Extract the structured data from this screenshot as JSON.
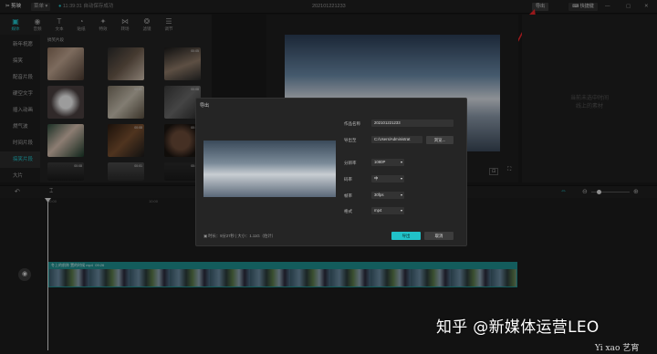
{
  "titlebar": {
    "app_name": "剪映",
    "menu_label": "菜单",
    "autosave": "11:39:31 自动保存成功",
    "project_title": "202101221233",
    "export_label": "导出",
    "shortcut_label": "快捷键"
  },
  "toolbar": {
    "items": [
      {
        "label": "媒体",
        "icon": "media-icon"
      },
      {
        "label": "音频",
        "icon": "audio-icon"
      },
      {
        "label": "文本",
        "icon": "text-icon"
      },
      {
        "label": "贴纸",
        "icon": "sticker-icon"
      },
      {
        "label": "特效",
        "icon": "effects-icon"
      },
      {
        "label": "转场",
        "icon": "transition-icon"
      },
      {
        "label": "滤镜",
        "icon": "filter-icon"
      },
      {
        "label": "调节",
        "icon": "adjust-icon"
      }
    ]
  },
  "sidebar": {
    "items": [
      {
        "label": "新年祝愿"
      },
      {
        "label": "搞笑"
      },
      {
        "label": "配音片段"
      },
      {
        "label": "硬空文字"
      },
      {
        "label": "插入动画"
      },
      {
        "label": "燃气波"
      },
      {
        "label": "时间片段"
      },
      {
        "label": "搞笑片段"
      },
      {
        "label": "大片"
      }
    ]
  },
  "grid": {
    "title": "搞笑片段",
    "durations": [
      "",
      "",
      "00:05",
      "",
      "00:01",
      "00:08",
      "",
      "00:08",
      "00:01",
      "00:08",
      "00:01",
      "00:08",
      "",
      "",
      ""
    ]
  },
  "player": {
    "placeholder": ""
  },
  "rightpanel": {
    "empty_line1": "当前未选中时间",
    "empty_line2": "线上的素材"
  },
  "timeline": {
    "ruler": [
      "00:00",
      "10:00",
      "20:00",
      "30:00"
    ],
    "clip_name": "冬上的前阵 置的时候 mp4",
    "clip_duration": "09:26"
  },
  "dialog": {
    "title": "导出",
    "name_label": "作品名称",
    "name_value": "202101221233",
    "path_label": "导出至",
    "path_value": "C:/Users/Administrat",
    "browse_label": "浏览...",
    "resolution_label": "分辨率",
    "resolution_value": "1080P",
    "bitrate_label": "码率",
    "bitrate_value": "中",
    "fps_label": "帧率",
    "fps_value": "30fps",
    "format_label": "格式",
    "format_value": "mp4",
    "info": "时长：9分27秒 | 大小：1.11G（估计）",
    "export_button": "导出",
    "cancel_button": "取消"
  },
  "watermark": {
    "text": "知乎 @新媒体运营LEO",
    "corner": "Yi xao 艺宵"
  },
  "colors": {
    "accent": "#21c2c9",
    "arrow": "#e8262a",
    "clip": "#1e8e8e"
  }
}
